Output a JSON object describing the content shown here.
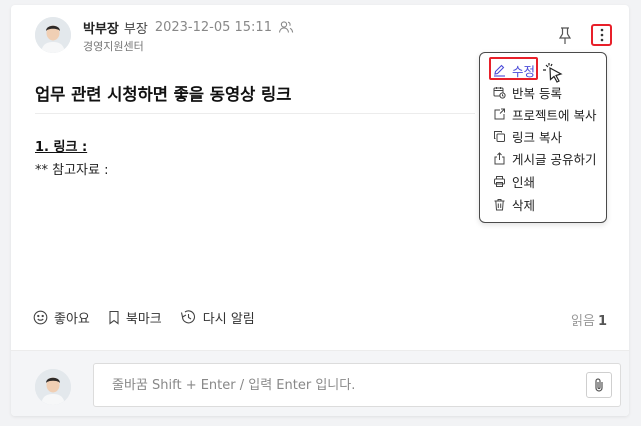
{
  "post": {
    "author_name": "박부장",
    "author_rank": "부장",
    "timestamp": "2023-12-05 15:11",
    "department": "경영지원센터",
    "title": "업무 관련 시청하면 좋을 동영상 링크",
    "body_line1": "1. 링크 :",
    "body_line2": "** 참고자료 :"
  },
  "actions": {
    "like_label": "좋아요",
    "bookmark_label": "북마크",
    "remind_label": "다시 알림",
    "read_label": "읽음",
    "read_count": "1"
  },
  "comment": {
    "placeholder": "줄바꿈 Shift + Enter / 입력 Enter 입니다."
  },
  "menu": {
    "items": [
      {
        "label": "수정",
        "icon": "pencil-icon"
      },
      {
        "label": "반복 등록",
        "icon": "repeat-calendar-icon"
      },
      {
        "label": "프로젝트에 복사",
        "icon": "copy-to-project-icon"
      },
      {
        "label": "링크 복사",
        "icon": "copy-icon"
      },
      {
        "label": "게시글 공유하기",
        "icon": "share-icon"
      },
      {
        "label": "인쇄",
        "icon": "printer-icon"
      },
      {
        "label": "삭제",
        "icon": "trash-icon"
      }
    ]
  },
  "colors": {
    "highlight": "#e8202a",
    "active_menu": "#4b4bd8"
  }
}
